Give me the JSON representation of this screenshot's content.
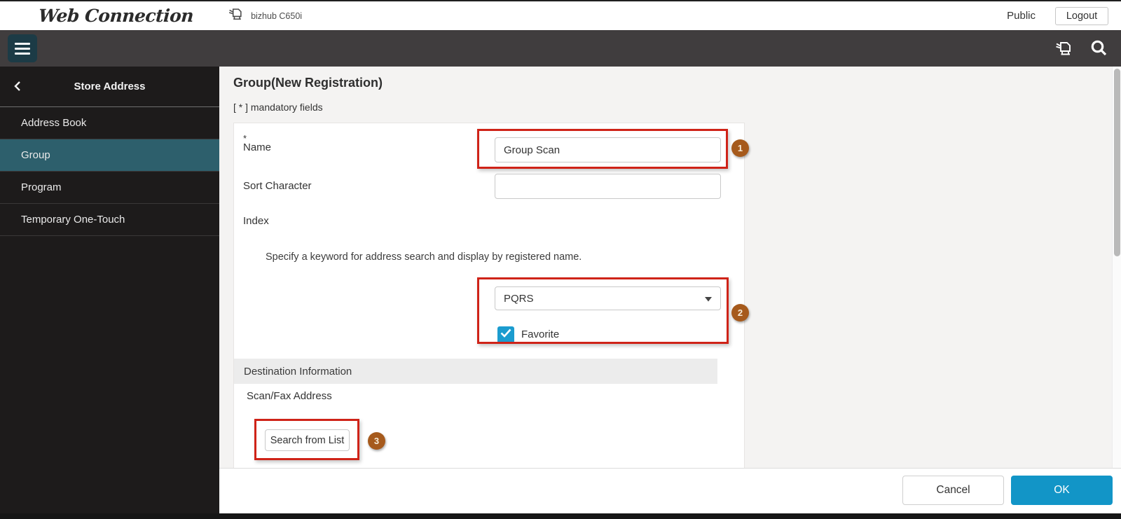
{
  "header": {
    "logo": "Web Connection",
    "device_name": "bizhub C650i",
    "user_label": "Public",
    "logout_label": "Logout"
  },
  "icons": {
    "menu": "hamburger",
    "device": "mfp-printer",
    "search": "magnifier",
    "back": "chevron-left",
    "dropdown": "caret-down",
    "checkbox": "checkmark"
  },
  "sidebar": {
    "title": "Store Address",
    "items": [
      {
        "label": "Address Book",
        "selected": false
      },
      {
        "label": "Group",
        "selected": true
      },
      {
        "label": "Program",
        "selected": false
      },
      {
        "label": "Temporary One-Touch",
        "selected": false
      }
    ]
  },
  "main": {
    "page_title": "Group(New Registration)",
    "mandatory_note": "[ * ] mandatory fields",
    "form": {
      "name_field": {
        "required_marker": "*",
        "label": "Name",
        "value": "Group Scan"
      },
      "sort_character_field": {
        "label": "Sort Character",
        "value": ""
      },
      "index_field": {
        "label": "Index",
        "hint": "Specify a keyword for address search and display by registered name.",
        "selected_option": "PQRS",
        "favorite": {
          "label": "Favorite",
          "checked": true
        }
      },
      "destination_section": {
        "title": "Destination Information",
        "scan_fax_label": "Scan/Fax Address",
        "search_button_label": "Search from List"
      }
    },
    "annotations": [
      {
        "number": "1"
      },
      {
        "number": "2"
      },
      {
        "number": "3"
      }
    ]
  },
  "footer": {
    "cancel_label": "Cancel",
    "ok_label": "OK"
  },
  "colors": {
    "accent_blue": "#1295c7",
    "checkbox_blue": "#1b9ccf",
    "sidebar_selected_teal": "#2d5f6c",
    "toolbar_bg": "#403d3e",
    "sidebar_bg": "#1d1b1b",
    "annotation_badge": "#a65a1c",
    "highlight_red": "#cf2318"
  }
}
